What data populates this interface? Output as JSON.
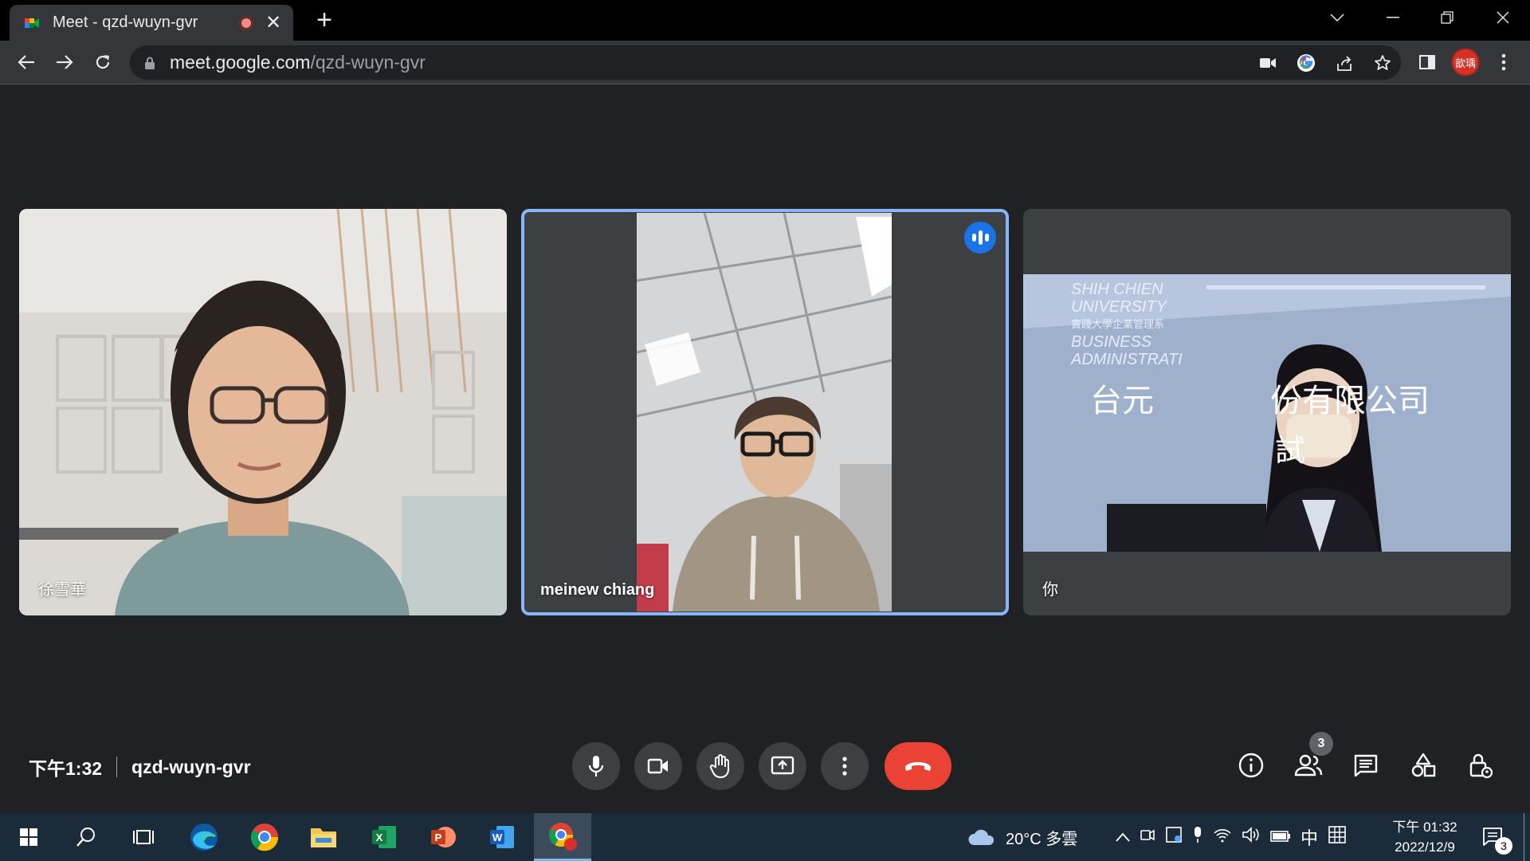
{
  "browser": {
    "tab_title": "Meet - qzd-wuyn-gvr",
    "url_host": "meet.google.com",
    "url_path": "/qzd-wuyn-gvr",
    "profile_label": "歆瑀"
  },
  "participants": [
    {
      "name": "徐雪華",
      "speaking": false
    },
    {
      "name": "meinew chiang",
      "speaking": true
    },
    {
      "name": "你",
      "speaking": false
    }
  ],
  "shared_slide": {
    "line1": "SHIH CHIEN",
    "line2": "UNIVERSITY",
    "line3": "實踐大學企業管理系",
    "line4": "BUSINESS",
    "line5": "ADMINISTRATI",
    "title_left": "台元",
    "title_right": "份有限公司",
    "subtitle": "試"
  },
  "meeting": {
    "time": "下午1:32",
    "code": "qzd-wuyn-gvr",
    "people_count": "3"
  },
  "taskbar": {
    "weather": "20°C 多雲",
    "ime": "中",
    "time": "下午 01:32",
    "date": "2022/12/9",
    "notifications": "3"
  }
}
